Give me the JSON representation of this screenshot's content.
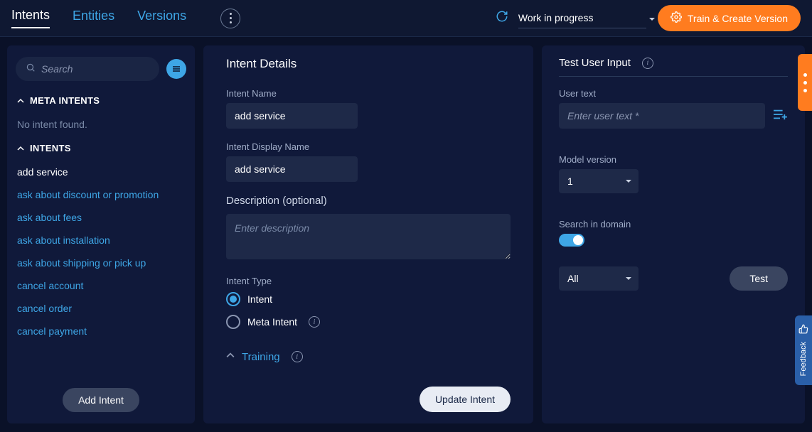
{
  "topbar": {
    "tabs": {
      "intents": "Intents",
      "entities": "Entities",
      "versions": "Versions"
    },
    "version_select": "Work in progress",
    "train_btn": "Train & Create Version"
  },
  "sidebar": {
    "search_placeholder": "Search",
    "section_meta": "META INTENTS",
    "no_meta": "No intent found.",
    "section_intents": "INTENTS",
    "items": [
      {
        "label": "add service",
        "active": true
      },
      {
        "label": "ask about discount or promotion",
        "active": false
      },
      {
        "label": "ask about fees",
        "active": false
      },
      {
        "label": "ask about installation",
        "active": false
      },
      {
        "label": "ask about shipping or pick up",
        "active": false
      },
      {
        "label": "cancel account",
        "active": false
      },
      {
        "label": "cancel order",
        "active": false
      },
      {
        "label": "cancel payment",
        "active": false
      }
    ],
    "add_btn": "Add Intent"
  },
  "main": {
    "title": "Intent Details",
    "name_label": "Intent Name",
    "name_value": "add service",
    "displayname_label": "Intent Display Name",
    "displayname_value": "add service",
    "desc_label": "Description (optional)",
    "desc_placeholder": "Enter description",
    "type_label": "Intent Type",
    "radio_intent": "Intent",
    "radio_meta": "Meta Intent",
    "training_label": "Training",
    "update_btn": "Update Intent"
  },
  "right": {
    "title": "Test User Input",
    "user_text_label": "User text",
    "user_text_placeholder": "Enter user text *",
    "model_version_label": "Model version",
    "model_version_value": "1",
    "search_domain_label": "Search in domain",
    "domain_value": "All",
    "test_btn": "Test"
  },
  "feedback": {
    "label": "Feedback"
  }
}
